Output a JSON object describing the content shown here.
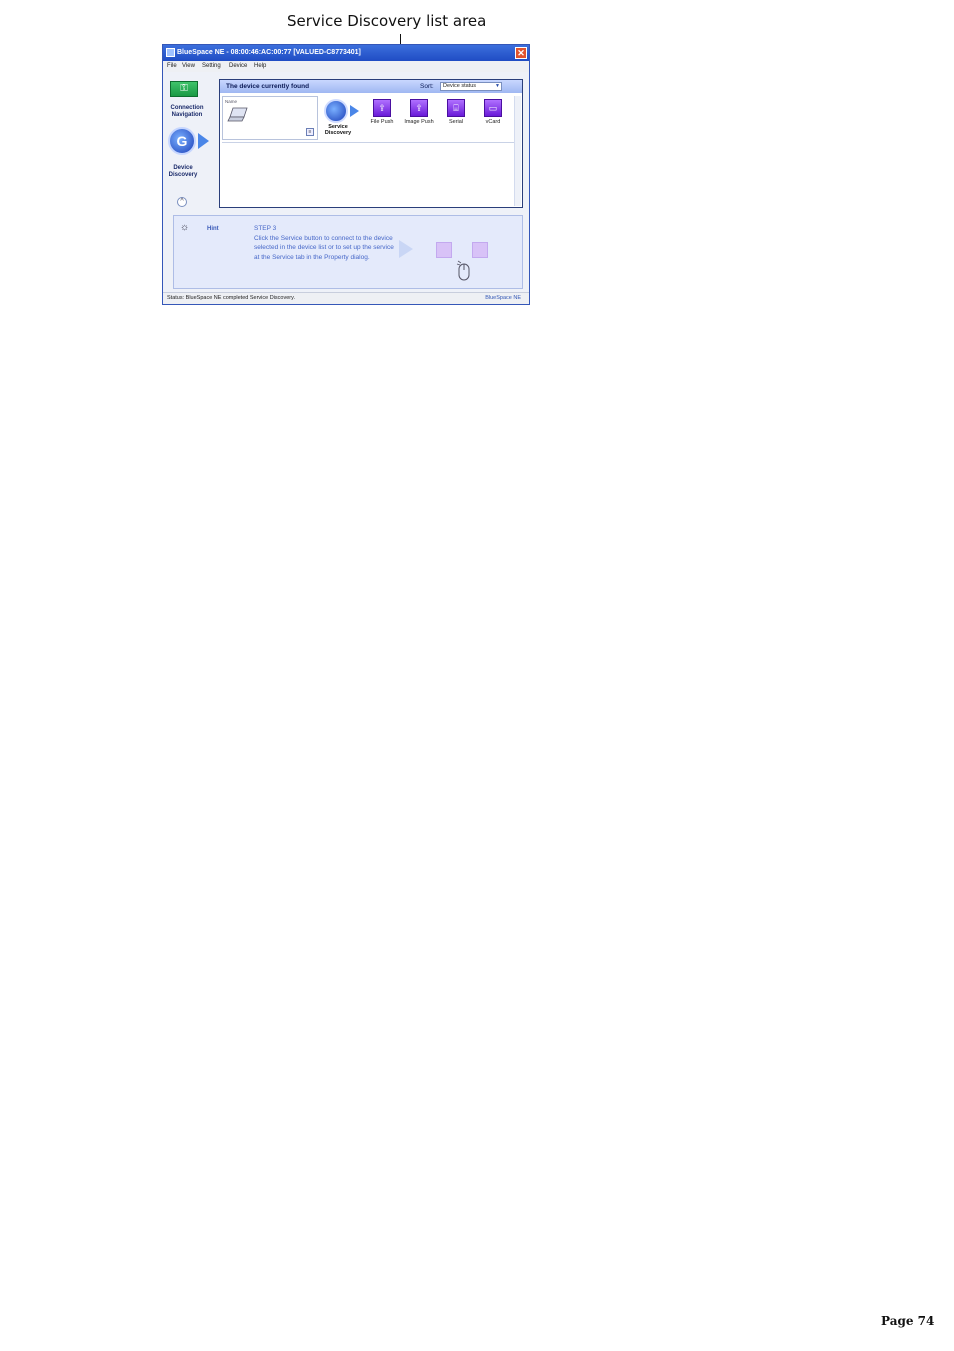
{
  "callout": {
    "label": "Service Discovery list area"
  },
  "window": {
    "title": "BlueSpace NE - 08:00:46:AC:00:77 [VALUED-C8773401]",
    "close_label": "✕"
  },
  "menu": [
    "File",
    "View",
    "Setting",
    "Device",
    "Help"
  ],
  "sidebar": {
    "connection_navigation": "Connection Navigation",
    "device_discovery": "Device Discovery"
  },
  "panel": {
    "title": "The device currently found",
    "sort_label": "Sort:",
    "sort_value": "Device status",
    "device_name": "Name",
    "service_discovery_label": "Service Discovery",
    "services": [
      {
        "label": "File Push",
        "icon": "file-push-icon"
      },
      {
        "label": "Image Push",
        "icon": "image-push-icon"
      },
      {
        "label": "Serial",
        "icon": "serial-icon"
      },
      {
        "label": "vCard",
        "icon": "vcard-icon"
      }
    ]
  },
  "hint": {
    "label": "Hint",
    "step": "STEP 3",
    "text": "Click the Service button to connect to the device selected in the device list or to set up the service at the Service tab in the Property dialog."
  },
  "status": {
    "text": "Status: BlueSpace NE completed Service Discovery.",
    "brand": "BlueSpace NE"
  },
  "page": {
    "number": "Page 74"
  },
  "colors": {
    "title_bar": "#1f4cc4",
    "accent": "#6a1bd8",
    "hint_text": "#4667c8"
  }
}
